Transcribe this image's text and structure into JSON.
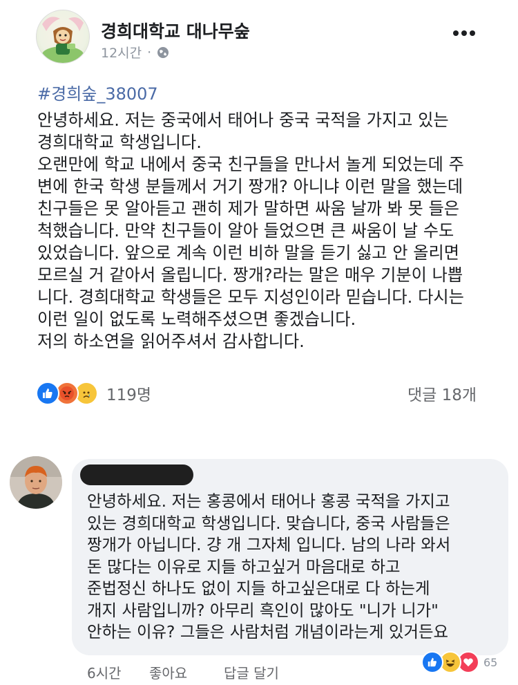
{
  "post": {
    "page_name": "경희대학교 대나무숲",
    "time": "12시간",
    "privacy_icon": "globe-icon",
    "hashtag": "#경희숲_38007",
    "body_lines": [
      "안녕하세요. 저는 중국에서 태어나 중국 국적을 가지고 있는",
      "경희대학교 학생입니다.",
      "오랜만에 학교 내에서 중국 친구들을 만나서 놀게 되었는데 주",
      "변에 한국 학생 분들께서 거기 짱개? 아니냐 이런 말을 했는데",
      "친구들은 못 알아듣고 괜히 제가 말하면 싸움 날까 봐 못 들은",
      "척했습니다. 만약 친구들이 알아 들었으면 큰 싸움이 날 수도",
      "있었습니다. 앞으로 계속 이런 비하 말을 듣기 싫고 안 올리면",
      "모르실 거 같아서 올립니다. 짱개?라는 말은 매우 기분이 나쁩",
      "니다. 경희대학교 학생들은 모두 지성인이라 믿습니다. 다시는",
      "이런 일이 없도록 노력해주셨으면 좋겠습니다.",
      "저의 하소연을 읽어주셔서 감사합니다."
    ],
    "reaction_icons": [
      "like-icon",
      "angry-icon",
      "sad-icon"
    ],
    "reaction_count": "119명",
    "comment_count": "댓글 18개"
  },
  "comment": {
    "text_lines": [
      "안녕하세요. 저는 홍콩에서 태어나 홍콩 국적을 가지고",
      "있는 경희대학교 학생입니다. 맞습니다, 중국 사람들은",
      "짱개가 아닙니다. 걍 개 그자체 입니다. 남의 나라 와서",
      "돈 많다는 이유로 지들 하고싶거 마음대로 하고",
      "준법정신 하나도 없이 지들 하고싶은대로 다 하는게",
      "개지 사람입니까? 아무리 흑인이 많아도 \"니가 니가\"",
      "안하는 이유? 그들은 사람처럼 개념이라는게 있거든요"
    ],
    "time": "6시간",
    "like_label": "좋아요",
    "reply_label": "답글 달기",
    "reaction_icons": [
      "like-icon",
      "haha-icon",
      "love-icon"
    ],
    "reaction_count": "65"
  },
  "colors": {
    "like_blue": "#1877f2",
    "angry_orange": "#f0733a",
    "sad_yellow": "#f7c53a",
    "love_red": "#f33e58",
    "hashtag_blue": "#4a6aa6",
    "bubble_gray": "#f0f2f5"
  }
}
